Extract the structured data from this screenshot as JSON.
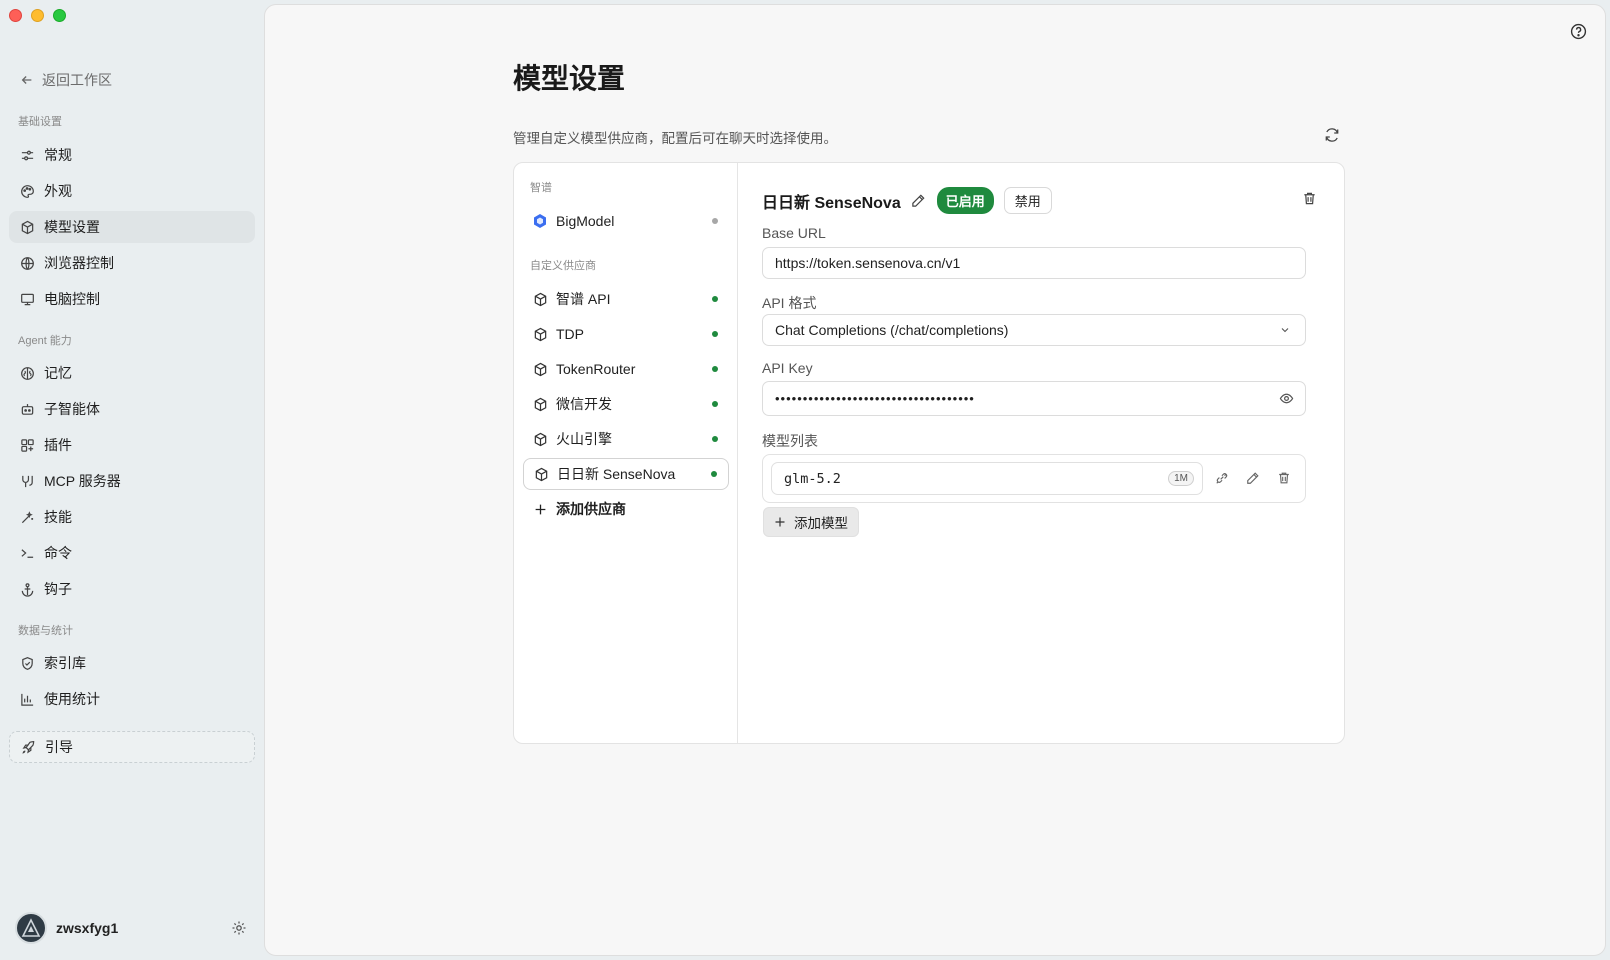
{
  "sidebar": {
    "back_label": "返回工作区",
    "sections": {
      "basic": "基础设置",
      "agent": "Agent 能力",
      "data": "数据与统计"
    },
    "items": {
      "general": "常规",
      "appearance": "外观",
      "model_settings": "模型设置",
      "browser_control": "浏览器控制",
      "computer_control": "电脑控制",
      "memory": "记忆",
      "sub_agents": "子智能体",
      "plugins": "插件",
      "mcp_servers": "MCP 服务器",
      "skills": "技能",
      "commands": "命令",
      "hooks": "钩子",
      "index": "索引库",
      "usage_stats": "使用统计",
      "guide": "引导"
    },
    "user": {
      "name": "zwsxfyg1"
    }
  },
  "main": {
    "title": "模型设置",
    "description": "管理自定义模型供应商，配置后可在聊天时选择使用。",
    "providers": {
      "group_zhipu": "智谱",
      "group_custom": "自定义供应商",
      "bigmodel": "BigModel",
      "custom_items": [
        "智谱 API",
        "TDP",
        "TokenRouter",
        "微信开发",
        "火山引擎",
        "日日新 SenseNova"
      ],
      "add_label": "添加供应商"
    },
    "detail": {
      "title": "日日新 SenseNova",
      "enabled_badge": "已启用",
      "disable_button": "禁用",
      "base_url_label": "Base URL",
      "base_url_value": "https://token.sensenova.cn/v1",
      "api_format_label": "API 格式",
      "api_format_value": "Chat Completions (/chat/completions)",
      "api_key_label": "API Key",
      "api_key_value": "••••••••••••••••••••••••••••••••••••",
      "model_list_label": "模型列表",
      "models": [
        {
          "name": "glm-5.2",
          "context": "1M"
        }
      ],
      "add_model_label": "添加模型"
    }
  },
  "colors": {
    "active_green": "#1f8a3e",
    "status_dot_on": "#1f8a3e",
    "status_dot_off": "#a7a7a7",
    "bigmodel_icon": "#3b6ef0"
  },
  "icons": {
    "back": "arrow-left-icon",
    "general": "sliders-icon",
    "appearance": "palette-icon",
    "model": "cube-icon",
    "browser": "globe-icon",
    "computer": "monitor-icon",
    "memory": "brain-icon",
    "sub_agents": "robot-icon",
    "plugins": "puzzle-icon",
    "mcp": "connection-icon",
    "skills": "wand-icon",
    "commands": "terminal-icon",
    "hooks": "anchor-icon",
    "index": "shield-icon",
    "usage": "bar-chart-icon",
    "guide": "rocket-icon"
  }
}
